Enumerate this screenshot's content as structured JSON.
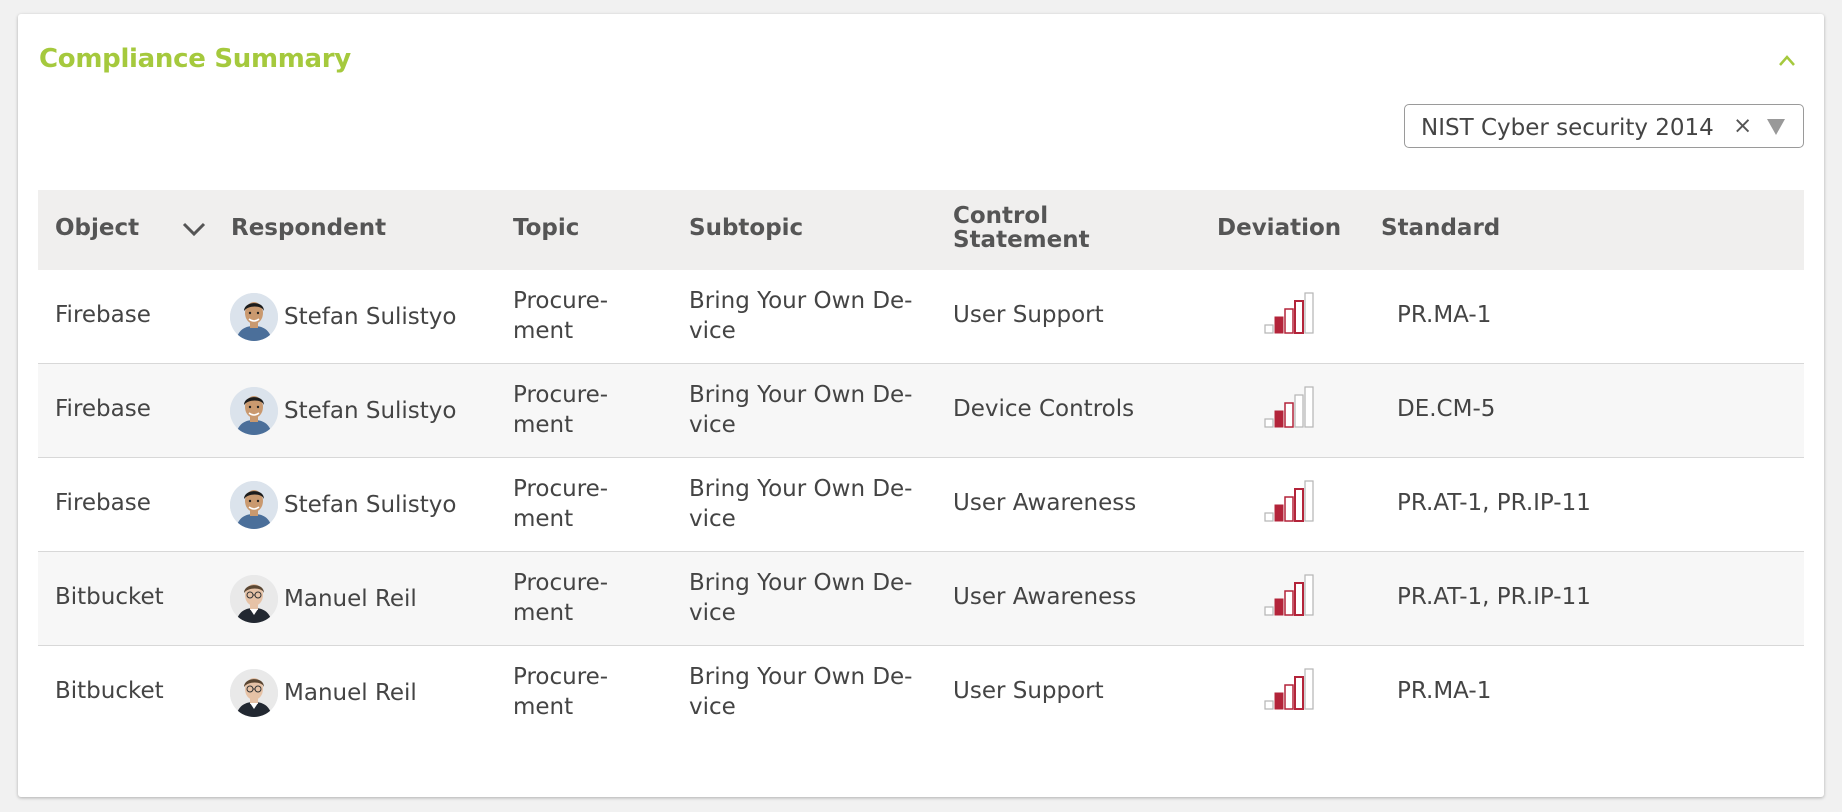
{
  "panel": {
    "title": "Compliance Summary"
  },
  "filter": {
    "selected": "NIST Cyber security 2014",
    "clear_glyph": "×"
  },
  "table": {
    "headers": {
      "object": "Object",
      "respondent": "Respondent",
      "topic": "Topic",
      "subtopic": "Subtopic",
      "control_line1": "Control",
      "control_line2": "Statement",
      "deviation": "Deviation",
      "standard": "Standard"
    },
    "rows": [
      {
        "object": "Firebase",
        "respondent": "Stefan Sulistyo",
        "avatar": "stefan",
        "topic_l1": "Procure-",
        "topic_l2": "ment",
        "subtopic_l1": "Bring Your Own De-",
        "subtopic_l2": "vice",
        "control": "User Support",
        "deviation_level": 3,
        "standard": "PR.MA-1"
      },
      {
        "object": "Firebase",
        "respondent": "Stefan Sulistyo",
        "avatar": "stefan",
        "topic_l1": "Procure-",
        "topic_l2": "ment",
        "subtopic_l1": "Bring Your Own De-",
        "subtopic_l2": "vice",
        "control": "Device Controls",
        "deviation_level": 2,
        "standard": "DE.CM-5"
      },
      {
        "object": "Firebase",
        "respondent": "Stefan Sulistyo",
        "avatar": "stefan",
        "topic_l1": "Procure-",
        "topic_l2": "ment",
        "subtopic_l1": "Bring Your Own De-",
        "subtopic_l2": "vice",
        "control": "User Awareness",
        "deviation_level": 3,
        "standard": "PR.AT-1, PR.IP-11"
      },
      {
        "object": "Bitbucket",
        "respondent": "Manuel Reil",
        "avatar": "manuel",
        "topic_l1": "Procure-",
        "topic_l2": "ment",
        "subtopic_l1": "Bring Your Own De-",
        "subtopic_l2": "vice",
        "control": "User Awareness",
        "deviation_level": 3,
        "standard": "PR.AT-1, PR.IP-11"
      },
      {
        "object": "Bitbucket",
        "respondent": "Manuel Reil",
        "avatar": "manuel",
        "topic_l1": "Procure-",
        "topic_l2": "ment",
        "subtopic_l1": "Bring Your Own De-",
        "subtopic_l2": "vice",
        "control": "User Support",
        "deviation_level": 3,
        "standard": "PR.MA-1"
      }
    ]
  },
  "colors": {
    "title": "#a5c93d",
    "deviation_active": "#b3243a",
    "deviation_inactive": "#b5b5b5"
  },
  "icons": {
    "collapse": "chevron-up-icon",
    "sort": "chevron-down-icon",
    "filter_arrow": "triangle-down-icon",
    "deviation": "signal-bars-icon"
  }
}
